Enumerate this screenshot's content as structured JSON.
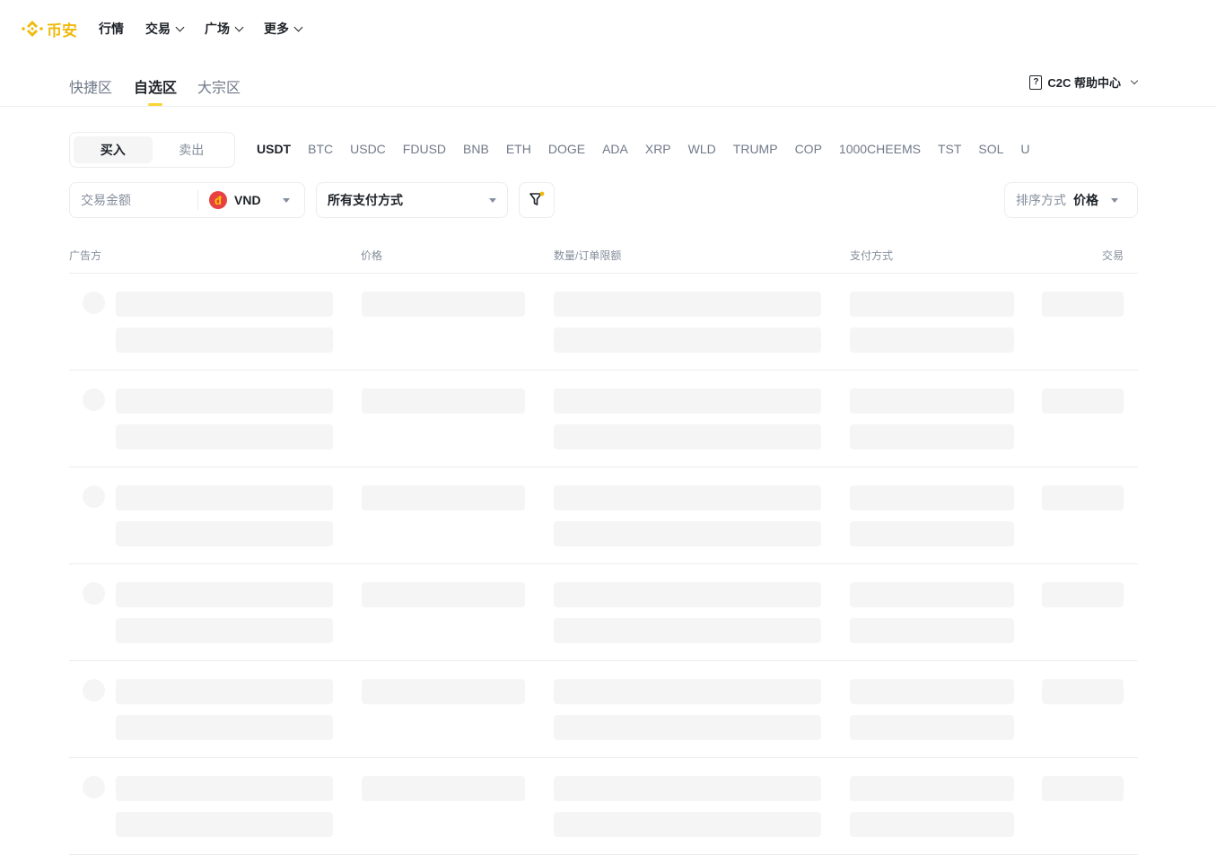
{
  "brand": {
    "name": "币安",
    "color": "#f0b90b",
    "logo_icon": "binance-diamond-icon"
  },
  "topnav": [
    {
      "label": "行情",
      "has_dropdown": false
    },
    {
      "label": "交易",
      "has_dropdown": true
    },
    {
      "label": "广场",
      "has_dropdown": true
    },
    {
      "label": "更多",
      "has_dropdown": true
    }
  ],
  "subnav": {
    "tabs": [
      "快捷区",
      "自选区",
      "大宗区"
    ],
    "active_index": 1,
    "indicator_color": "#fcd535",
    "help": {
      "icon": "question-box-icon",
      "glyph": "?",
      "label": "C2C 帮助中心"
    }
  },
  "trade": {
    "buy": "买入",
    "sell": "卖出",
    "active": "buy"
  },
  "coins": [
    "USDT",
    "BTC",
    "USDC",
    "FDUSD",
    "BNB",
    "ETH",
    "DOGE",
    "ADA",
    "XRP",
    "WLD",
    "TRUMP",
    "COP",
    "1000CHEEMS",
    "TST",
    "SOL",
    "U"
  ],
  "active_coin": "USDT",
  "filters": {
    "amount_placeholder": "交易金额",
    "currency": {
      "code": "VND",
      "flag_glyph": "đ",
      "flag_color": "#e84142"
    },
    "payment": "所有支付方式",
    "filter_icon": "funnel-icon",
    "sort_label": "排序方式",
    "sort_value": "价格"
  },
  "table": {
    "headers": [
      "广告方",
      "价格",
      "数量/订单限额",
      "支付方式",
      "交易"
    ],
    "loading_rows": 6
  }
}
